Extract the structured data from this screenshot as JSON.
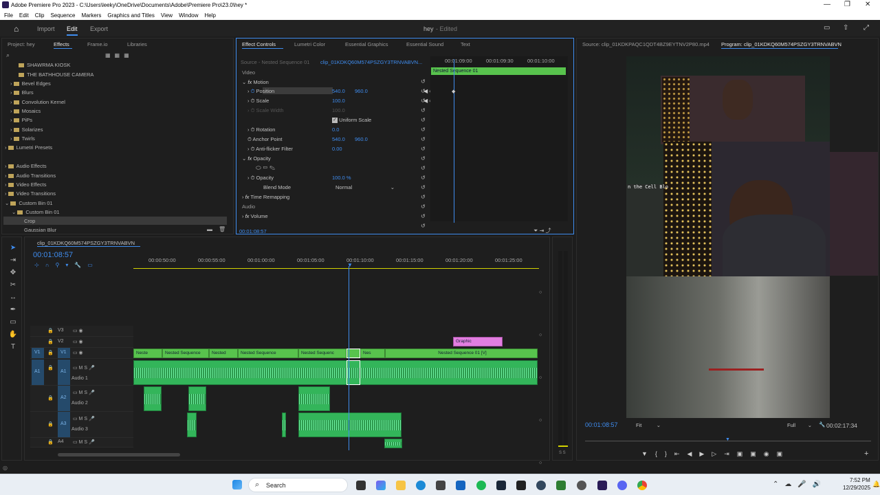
{
  "window": {
    "title": "Adobe Premiere Pro 2023 - C:\\Users\\leeky\\OneDrive\\Documents\\Adobe\\Premiere Pro\\23.0\\hey *"
  },
  "menu": [
    "File",
    "Edit",
    "Clip",
    "Sequence",
    "Markers",
    "Graphics and Titles",
    "View",
    "Window",
    "Help"
  ],
  "workspace": {
    "import": "Import",
    "edit": "Edit",
    "export": "Export",
    "project_name": "hey",
    "project_status": "- Edited"
  },
  "project_panel": {
    "tabs": [
      "Project: hey",
      "Effects",
      "Frame.io",
      "Libraries"
    ],
    "active_tab": "Effects",
    "items": [
      "SHAWRMA KIOSK",
      "THE BATHHOUSE CAMERA",
      "Bevel Edges",
      "Blurs",
      "Convolution Kernel",
      "Mosaics",
      "PiPs",
      "Solarizes",
      "Twirls",
      "Lumetri Presets",
      "Audio Effects",
      "Audio Transitions",
      "Video Effects",
      "Video Transitions",
      "Custom Bin 01",
      "Custom Bin 01",
      "Crop",
      "Gaussian Blur"
    ]
  },
  "effect_controls": {
    "tabs": [
      "Effect Controls",
      "Lumetri Color",
      "Essential Graphics",
      "Essential Sound",
      "Text"
    ],
    "source_label": "Source - Nested Sequence 01",
    "clip_label": "clip_01KDKQ60M574PSZGY3TRNVABVN...",
    "section_video": "Video",
    "motion": "Motion",
    "position": "Position",
    "pos_x": "540.0",
    "pos_y": "960.0",
    "scale": "Scale",
    "scale_val": "100.0",
    "scale_width": "Scale Width",
    "scale_width_val": "100.0",
    "uniform_scale": "Uniform Scale",
    "rotation": "Rotation",
    "rotation_val": "0.0",
    "anchor": "Anchor Point",
    "anchor_x": "540.0",
    "anchor_y": "960.0",
    "antiflicker": "Anti-flicker Filter",
    "antiflicker_val": "0.00",
    "opacity_group": "Opacity",
    "opacity": "Opacity",
    "opacity_val": "100.0 %",
    "blend": "Blend Mode",
    "blend_val": "Normal",
    "time_remap": "Time Remapping",
    "section_audio": "Audio",
    "volume": "Volume",
    "timecode": "00:01:08:57",
    "ruler": [
      "00:01:09:00",
      "00:01:09:30",
      "00:01:10:00"
    ],
    "nested_clip": "Nested Sequence 01"
  },
  "program_monitor": {
    "source_tab": "Source: clip_01KDKPAQC1QDT4BZ9EYTNV2P80.mp4",
    "program_tab": "Program: clip_01KDKQ60M574PSZGY3TRNVABVN",
    "overlay_text": "n the Cell Blo",
    "timecode": "00:01:08:57",
    "fit": "Fit",
    "quality": "Full",
    "duration": "00:02:17:34"
  },
  "timeline": {
    "sequence_name": "clip_01KDKQ60M574PSZGY3TRNVABVN",
    "timecode": "00:01:08:57",
    "ruler": [
      "00:00:50:00",
      "00:00:55:00",
      "00:01:00:00",
      "00:01:05:00",
      "00:01:10:00",
      "00:01:15:00",
      "00:01:20:00",
      "00:01:25:00"
    ],
    "tracks_video": [
      "V3",
      "V2",
      "V1"
    ],
    "tracks_audio": [
      "A1",
      "A2",
      "A3",
      "A4"
    ],
    "audio_names": [
      "Audio 1",
      "Audio 2",
      "Audio 3"
    ],
    "graphic_clip": "Graphic",
    "v1_clips": [
      "Neste",
      "Nested Sequence",
      "Nested",
      "Nested Sequence",
      "Nested Sequenc",
      "Nes",
      "Nested Sequence 01 [V]"
    ],
    "meter_labels": "S S"
  },
  "taskbar": {
    "search": "Search",
    "time": "7:52 PM",
    "date": "12/29/2025"
  },
  "colors": {
    "accent_blue": "#3f8df0",
    "clip_green": "#58c34d",
    "audio_green": "#33b55a",
    "graphic_pink": "#e27ee0"
  }
}
